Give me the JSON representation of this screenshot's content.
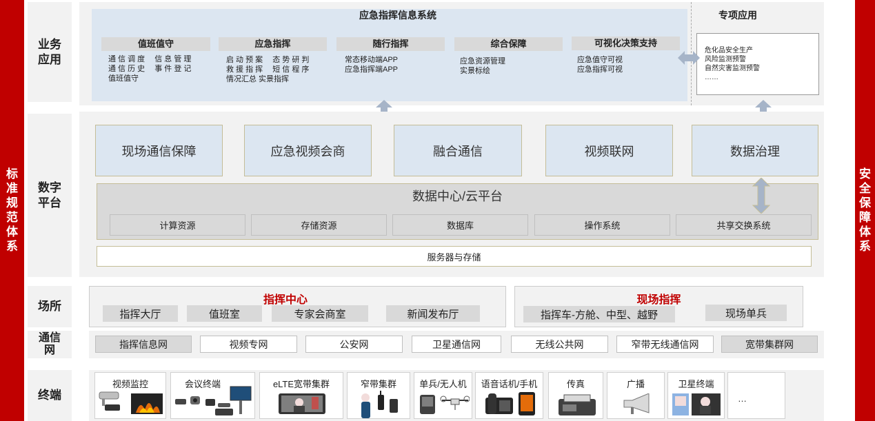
{
  "left_bar": "标准规范体系",
  "right_bar": "安全保障体系",
  "layers": {
    "business": "业务应用",
    "digital": "数字平台",
    "venue": "场所",
    "network": "通信网",
    "terminal": "终端"
  },
  "business": {
    "system_title": "应急指挥信息系统",
    "special_title": "专项应用",
    "categories": [
      {
        "title": "值班值守",
        "lines": [
          "通 信 调 度　 信 息 管 理",
          "通 信 历 史　 事 件 登 记",
          "值班值守"
        ]
      },
      {
        "title": "应急指挥",
        "lines": [
          "启 动 预 案　 态 势 研 判",
          "救 援 指 挥　 短 信 程 序",
          "情况汇总 实景指挥"
        ]
      },
      {
        "title": "随行指挥",
        "lines": [
          "常态移动端APP",
          "应急指挥端APP"
        ]
      },
      {
        "title": "综合保障",
        "lines": [
          "应急资源管理",
          "实景标绘"
        ]
      },
      {
        "title": "可视化决策支持",
        "lines": [
          "应急值守可视",
          "应急指挥可视"
        ]
      }
    ],
    "special_items": [
      "危化品安全生产",
      "风险监测预警",
      "自然灾害监测预警",
      "……"
    ]
  },
  "digital": {
    "top_boxes": [
      "现场通信保障",
      "应急视频会商",
      "融合通信",
      "视频联网",
      "数据治理"
    ],
    "datacenter_title": "数据中心/云平台",
    "resources": [
      "计算资源",
      "存储资源",
      "数据库",
      "操作系统",
      "共享交换系统"
    ],
    "server": "服务器与存储"
  },
  "venue": {
    "command_center": {
      "title": "指挥中心",
      "items": [
        "指挥大厅",
        "值班室",
        "专家会商室",
        "新闻发布厅"
      ]
    },
    "field_command": {
      "title": "现场指挥",
      "items": [
        "指挥车-方舱、中型、越野",
        "现场单兵"
      ]
    }
  },
  "network": {
    "items": [
      "指挥信息网",
      "视频专网",
      "公安网",
      "卫星通信网",
      "无线公共网",
      "窄带无线通信网",
      "宽带集群网"
    ]
  },
  "terminal": {
    "items": [
      "视频监控",
      "会议终端",
      "eLTE宽带集群",
      "窄带集群",
      "单兵/无人机",
      "语音话机/手机",
      "传真",
      "广播",
      "卫星终端",
      "…"
    ]
  },
  "colors": {
    "red": "#c00000",
    "accent_red": "#c00000",
    "blue_panel": "#dce6f1",
    "grey_panel": "#f2f2f2",
    "arrow": "#a6b4c8"
  }
}
